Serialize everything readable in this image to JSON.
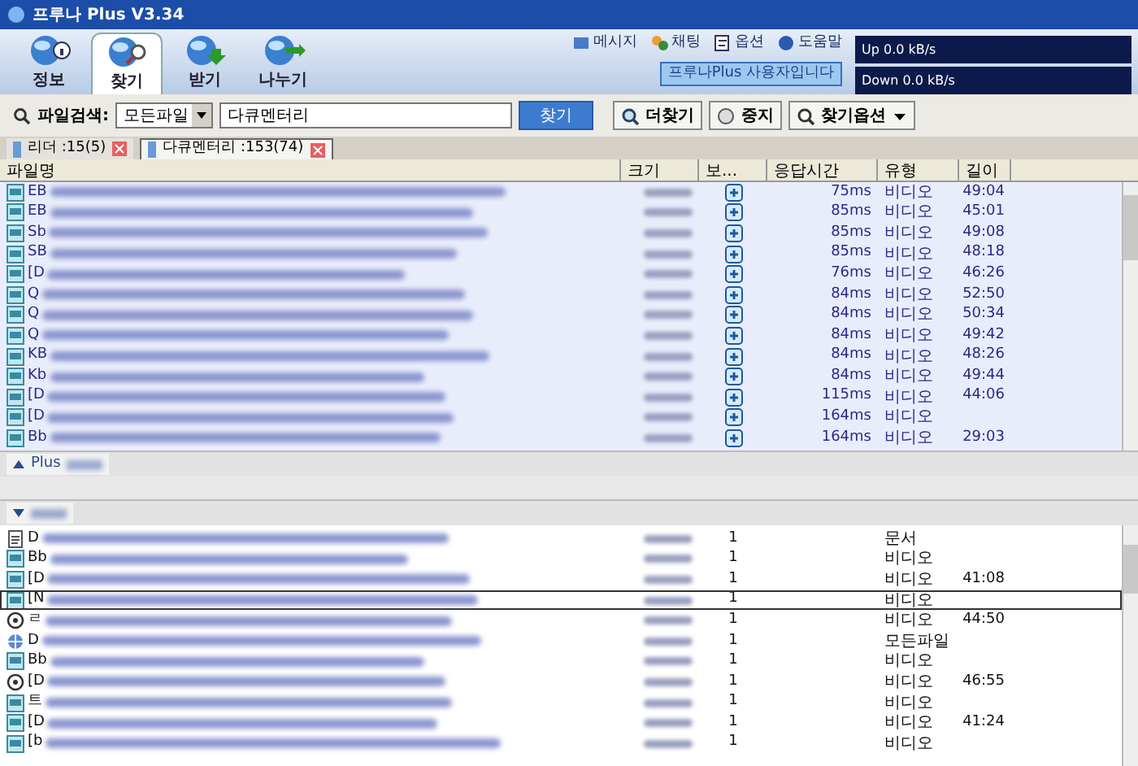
{
  "window": {
    "title": "프루나 Plus V3.34"
  },
  "main_tabs": [
    {
      "label": "정보",
      "selected": false,
      "kind": "info"
    },
    {
      "label": "찾기",
      "selected": true,
      "kind": "search"
    },
    {
      "label": "받기",
      "selected": false,
      "kind": "download"
    },
    {
      "label": "나누기",
      "selected": false,
      "kind": "share"
    }
  ],
  "menu": [
    {
      "label": "메시지",
      "kind": "message"
    },
    {
      "label": "채팅",
      "kind": "chat"
    },
    {
      "label": "옵션",
      "kind": "option"
    },
    {
      "label": "도움말",
      "kind": "help"
    }
  ],
  "banner": "프루나Plus 사용자입니다",
  "speed": {
    "up": "Up 0.0 kB/s",
    "down": "Down 0.0 kB/s"
  },
  "search": {
    "label": "파일검색:",
    "filter": "모든파일",
    "value": "다큐멘터리",
    "button": "찾기"
  },
  "actions": [
    {
      "label": "더찾기",
      "kind": "more"
    },
    {
      "label": "중지",
      "kind": "stop"
    },
    {
      "label": "찾기옵션",
      "kind": "options"
    }
  ],
  "result_tabs": [
    {
      "label": "리더 :15(5)",
      "selected": false
    },
    {
      "label": "다큐멘터리 :153(74)",
      "selected": true
    }
  ],
  "columns": [
    "파일명",
    "크기",
    "보...",
    "응답시간",
    "유형",
    "길이"
  ],
  "plus_rows": [
    {
      "name": "EB",
      "response": "75ms",
      "type": "비디오",
      "length": "49:04"
    },
    {
      "name": "EB",
      "response": "85ms",
      "type": "비디오",
      "length": "45:01"
    },
    {
      "name": "Sb",
      "response": "85ms",
      "type": "비디오",
      "length": "49:08"
    },
    {
      "name": "SB",
      "response": "85ms",
      "type": "비디오",
      "length": "48:18"
    },
    {
      "name": "[D",
      "response": "76ms",
      "type": "비디오",
      "length": "46:26"
    },
    {
      "name": "Q",
      "response": "84ms",
      "type": "비디오",
      "length": "52:50"
    },
    {
      "name": "Q",
      "response": "84ms",
      "type": "비디오",
      "length": "50:34"
    },
    {
      "name": "Q",
      "response": "84ms",
      "type": "비디오",
      "length": "49:42"
    },
    {
      "name": "KB",
      "response": "84ms",
      "type": "비디오",
      "length": "48:26"
    },
    {
      "name": "Kb",
      "response": "84ms",
      "type": "비디오",
      "length": "49:44"
    },
    {
      "name": "[D",
      "response": "115ms",
      "type": "비디오",
      "length": "44:06"
    },
    {
      "name": "[D",
      "response": "164ms",
      "type": "비디오"
    },
    {
      "name": "Bb",
      "response": "164ms",
      "type": "비디오",
      "length": "29:03"
    }
  ],
  "plus_section": {
    "label": "Plus",
    "expanded": false
  },
  "normal_section": {
    "expanded": true
  },
  "normal_rows": [
    {
      "name": "D",
      "kind": "document",
      "sources": "1",
      "type": "문서",
      "focused": false
    },
    {
      "name": "Bb",
      "kind": "video",
      "sources": "1",
      "type": "비디오",
      "focused": false
    },
    {
      "name": "[D",
      "kind": "video",
      "sources": "1",
      "type": "비디오",
      "length": "41:08",
      "focused": false
    },
    {
      "name": "[N",
      "kind": "video",
      "sources": "1",
      "type": "비디오",
      "focused": true
    },
    {
      "name": "ㄹ",
      "kind": "media",
      "sources": "1",
      "type": "비디오",
      "length": "44:50",
      "focused": false
    },
    {
      "name": "D",
      "kind": "web",
      "sources": "1",
      "type": "모든파일",
      "focused": false
    },
    {
      "name": "Bb",
      "kind": "video",
      "sources": "1",
      "type": "비디오",
      "focused": false
    },
    {
      "name": "[D",
      "kind": "media",
      "sources": "1",
      "type": "비디오",
      "length": "46:55",
      "focused": false
    },
    {
      "name": "트",
      "kind": "video",
      "sources": "1",
      "type": "비디오",
      "focused": false
    },
    {
      "name": "[D",
      "kind": "video",
      "sources": "1",
      "type": "비디오",
      "length": "41:24",
      "focused": false
    },
    {
      "name": "[b",
      "kind": "video",
      "sources": "1",
      "type": "비디오",
      "focused": false
    }
  ]
}
